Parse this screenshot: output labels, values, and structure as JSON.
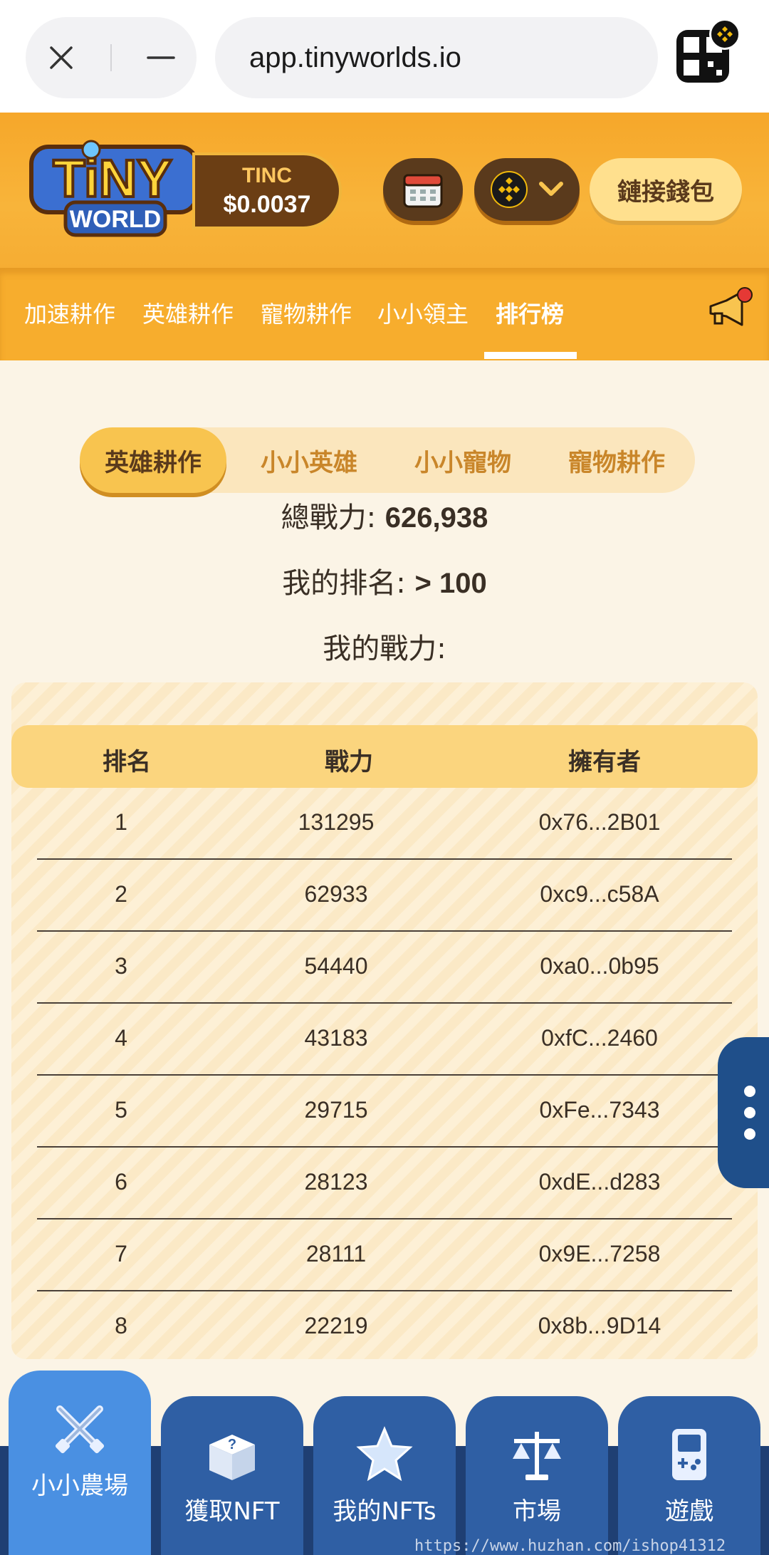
{
  "browser": {
    "url": "app.tinyworlds.io"
  },
  "header": {
    "logo_top": "TiNY",
    "logo_bottom": "WORLD",
    "token_name": "TINC",
    "token_price": "$0.0037",
    "wallet_button": "鏈接錢包"
  },
  "top_nav": {
    "tabs": [
      "加速耕作",
      "英雄耕作",
      "寵物耕作",
      "小小領主",
      "排行榜"
    ],
    "active": "排行榜"
  },
  "sub_tabs": {
    "items": [
      "英雄耕作",
      "小小英雄",
      "小小寵物",
      "寵物耕作"
    ],
    "active": "英雄耕作"
  },
  "stats": {
    "total_power_label": "總戰力:",
    "total_power_value": "626,938",
    "my_rank_label": "我的排名:",
    "my_rank_value": "> 100",
    "my_power_label": "我的戰力:"
  },
  "table": {
    "headers": [
      "排名",
      "戰力",
      "擁有者"
    ],
    "rows": [
      {
        "rank": "1",
        "power": "131295",
        "owner": "0x76...2B01"
      },
      {
        "rank": "2",
        "power": "62933",
        "owner": "0xc9...c58A"
      },
      {
        "rank": "3",
        "power": "54440",
        "owner": "0xa0...0b95"
      },
      {
        "rank": "4",
        "power": "43183",
        "owner": "0xfC...2460"
      },
      {
        "rank": "5",
        "power": "29715",
        "owner": "0xFe...7343"
      },
      {
        "rank": "6",
        "power": "28123",
        "owner": "0xdE...d283"
      },
      {
        "rank": "7",
        "power": "28111",
        "owner": "0x9E...7258"
      },
      {
        "rank": "8",
        "power": "22219",
        "owner": "0x8b...9D14"
      }
    ]
  },
  "bottom_nav": {
    "items": [
      "小小農場",
      "獲取NFT",
      "我的NFTs",
      "市場",
      "遊戲"
    ],
    "active": "小小農場"
  },
  "watermark": "https://www.huzhan.com/ishop41312",
  "colors": {
    "header_orange": "#f7ad2d",
    "table_header": "#fbd57e",
    "bottom_nav_blue": "#2f5fa4",
    "active_nav_blue": "#4a90e2"
  }
}
